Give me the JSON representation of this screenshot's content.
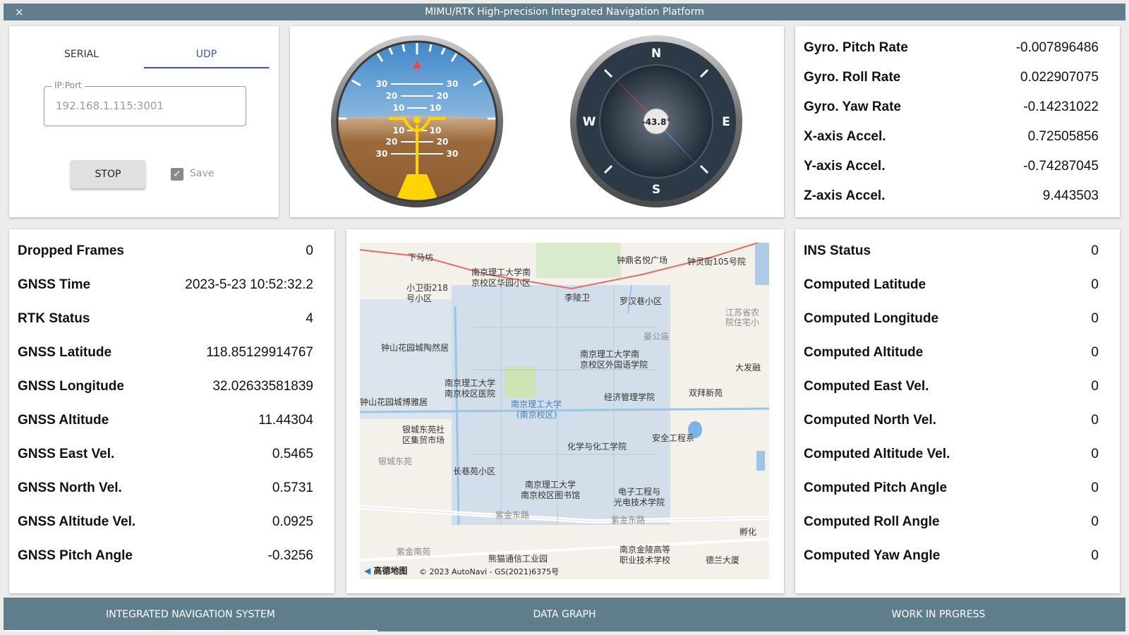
{
  "window": {
    "title": "MIMU/RTK High-precision Integrated Navigation Platform",
    "close_icon": "×"
  },
  "connection": {
    "tabs": [
      "SERIAL",
      "UDP"
    ],
    "active_tab": "UDP",
    "ip_label": "IP:Port",
    "ip_value": "192.168.1.115:3001",
    "stop_label": "STOP",
    "save_label": "Save",
    "save_checked": true
  },
  "attitude": {
    "pitch_marks_up": [
      "30",
      "20",
      "10"
    ],
    "pitch_marks_down": [
      "10",
      "20",
      "30"
    ]
  },
  "compass": {
    "heading": "-43.8°",
    "n": "N",
    "e": "E",
    "s": "S",
    "w": "W"
  },
  "imu": [
    {
      "label": "Gyro. Pitch Rate",
      "value": "-0.007896486"
    },
    {
      "label": "Gyro. Roll Rate",
      "value": "0.022907075"
    },
    {
      "label": "Gyro. Yaw Rate",
      "value": "-0.14231022"
    },
    {
      "label": "X-axis Accel.",
      "value": "0.72505856"
    },
    {
      "label": "Y-axis Accel.",
      "value": "-0.74287045"
    },
    {
      "label": "Z-axis Accel.",
      "value": "9.443503"
    }
  ],
  "gnss": [
    {
      "label": "Dropped Frames",
      "value": "0"
    },
    {
      "label": "GNSS Time",
      "value": "2023-5-23 10:52:32.2"
    },
    {
      "label": "RTK Status",
      "value": "4"
    },
    {
      "label": "GNSS Latitude",
      "value": "118.85129914767"
    },
    {
      "label": "GNSS Longitude",
      "value": "32.02633581839"
    },
    {
      "label": "GNSS Altitude",
      "value": "11.44304"
    },
    {
      "label": "GNSS East Vel.",
      "value": "0.5465"
    },
    {
      "label": "GNSS North Vel.",
      "value": "0.5731"
    },
    {
      "label": "GNSS Altitude Vel.",
      "value": "0.0925"
    },
    {
      "label": "GNSS Pitch Angle",
      "value": "-0.3256"
    }
  ],
  "ins": [
    {
      "label": "INS Status",
      "value": "0"
    },
    {
      "label": "Computed Latitude",
      "value": "0"
    },
    {
      "label": "Computed Longitude",
      "value": "0"
    },
    {
      "label": "Computed Altitude",
      "value": "0"
    },
    {
      "label": "Computed East Vel.",
      "value": "0"
    },
    {
      "label": "Computed North Vel.",
      "value": "0"
    },
    {
      "label": "Computed Altitude Vel.",
      "value": "0"
    },
    {
      "label": "Computed Pitch Angle",
      "value": "0"
    },
    {
      "label": "Computed Roll Angle",
      "value": "0"
    },
    {
      "label": "Computed Yaw Angle",
      "value": "0"
    }
  ],
  "map": {
    "labels": [
      "下马坊",
      "南京理工大学南",
      "京校区华园小区",
      "钟鼎名悦广场",
      "钟灵街105号院",
      "小卫街218",
      "号小区",
      "李陵卫",
      "罗汉巷小区",
      "江苏省农",
      "院住宅小",
      "晏公庙",
      "钟山花园城陶然居",
      "南京理工大学南",
      "京校区外国语学院",
      "大发融",
      "南京理工大学",
      "南京校区医院",
      "经济管理学院",
      "双拜新苑",
      "钟山花园城博雅居",
      "南京理工大学",
      "(南京校区)",
      "银城东苑社",
      "区集贸市场",
      "安全工程系",
      "化学与化工学院",
      "银城东苑",
      "长巷苑小区",
      "南京理工大学",
      "南京校区图书馆",
      "电子工程与",
      "光电技术学院",
      "紫金东路",
      "紫金东路",
      "孵化",
      "紫金南苑",
      "熊猫通信工业园",
      "南京金陵高等",
      "职业技术学校",
      "德兰大厦"
    ],
    "logo": "高德地图",
    "copyright": "© 2023 AutoNavi - GS(2021)6375号"
  },
  "bottom_nav": {
    "tabs": [
      "INTEGRATED NAVIGATION SYSTEM",
      "DATA GRAPH",
      "WORK IN PRGRESS"
    ],
    "active": "INTEGRATED NAVIGATION SYSTEM"
  },
  "colors": {
    "header": "#607d8b",
    "accent": "#3f51b5",
    "sky": "#5b9bd3",
    "ground": "#9b6a3c",
    "horizon_marker": "#ffd400",
    "compass_north": "#d9566a",
    "compass_south": "#4a90d9"
  },
  "icons": [
    "close-icon",
    "checkbox-icon"
  ]
}
